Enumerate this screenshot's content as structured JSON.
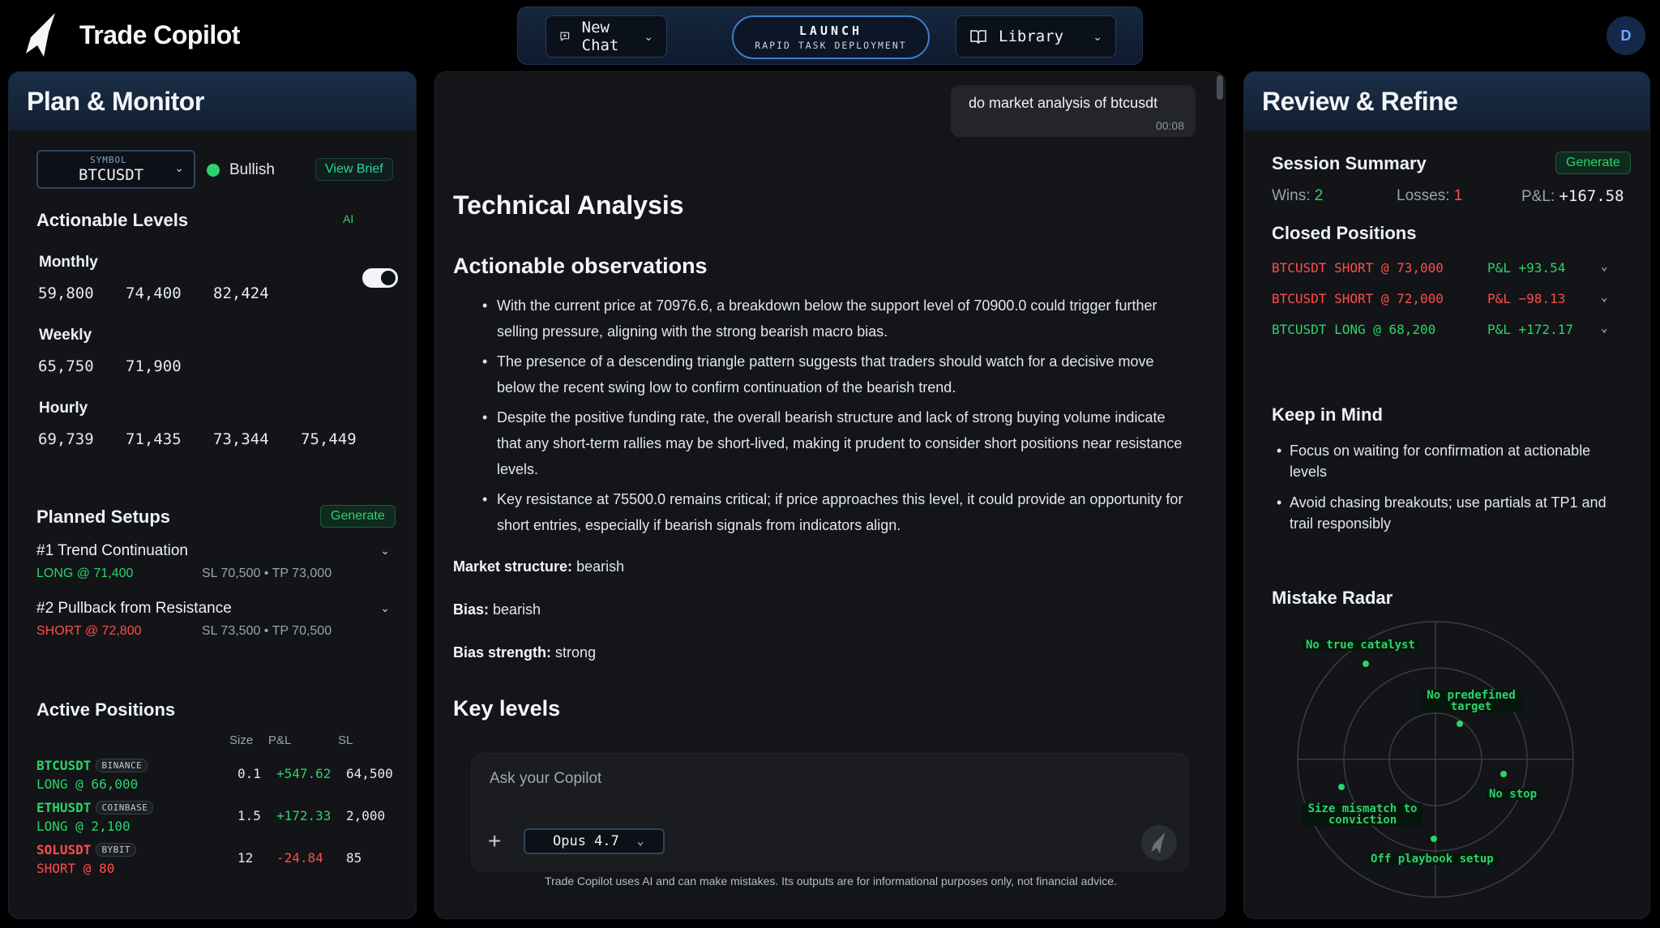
{
  "app": {
    "title": "Trade Copilot",
    "avatar_initial": "D"
  },
  "topnav": {
    "new_chat": "New Chat",
    "launch_title": "LAUNCH",
    "launch_subtitle": "RAPID TASK DEPLOYMENT",
    "library": "Library"
  },
  "left": {
    "title": "Plan & Monitor",
    "symbol_label": "SYMBOL",
    "symbol_value": "BTCUSDT",
    "sentiment": "Bullish",
    "view_brief": "View Brief",
    "actionable_title": "Actionable Levels",
    "ai_label": "AI",
    "levels": [
      {
        "name": "Monthly",
        "values": [
          "59,800",
          "74,400",
          "82,424"
        ]
      },
      {
        "name": "Weekly",
        "values": [
          "65,750",
          "71,900"
        ]
      },
      {
        "name": "Hourly",
        "values": [
          "69,739",
          "71,435",
          "73,344",
          "75,449"
        ]
      }
    ],
    "planned_title": "Planned Setups",
    "generate": "Generate",
    "setups": [
      {
        "title": "#1 Trend Continuation",
        "entry": "LONG @ 71,400",
        "targets": "SL 70,500 • TP 73,000",
        "side": "long"
      },
      {
        "title": "#2 Pullback from Resistance",
        "entry": "SHORT @ 72,800",
        "targets": "SL 73,500 • TP 70,500",
        "side": "short"
      }
    ],
    "active_title": "Active Positions",
    "cols": {
      "size": "Size",
      "pnl": "P&L",
      "sl": "SL"
    },
    "positions": [
      {
        "symbol": "BTCUSDT",
        "exchange": "BINANCE",
        "entry": "LONG @ 66,000",
        "size": "0.1",
        "pnl": "+547.62",
        "sl": "64,500",
        "side": "long"
      },
      {
        "symbol": "ETHUSDT",
        "exchange": "COINBASE",
        "entry": "LONG @ 2,100",
        "size": "1.5",
        "pnl": "+172.33",
        "sl": "2,000",
        "side": "long"
      },
      {
        "symbol": "SOLUSDT",
        "exchange": "BYBIT",
        "entry": "SHORT @ 80",
        "size": "12",
        "pnl": "-24.84",
        "sl": "85",
        "side": "short"
      }
    ]
  },
  "center": {
    "user_message": "do market analysis of btcusdt",
    "user_time": "00:08",
    "heading": "Technical Analysis",
    "obs_heading": "Actionable observations",
    "observations": [
      "With the current price at 70976.6, a breakdown below the support level of 70900.0 could trigger further selling pressure, aligning with the strong bearish macro bias.",
      "The presence of a descending triangle pattern suggests that traders should watch for a decisive move below the recent swing low to confirm continuation of the bearish trend.",
      "Despite the positive funding rate, the overall bearish structure and lack of strong buying volume indicate that any short-term rallies may be short-lived, making it prudent to consider short positions near resistance levels.",
      "Key resistance at 75500.0 remains critical; if price approaches this level, it could provide an opportunity for short entries, especially if bearish signals from indicators align."
    ],
    "market_structure_label": "Market structure:",
    "market_structure": "bearish",
    "bias_label": "Bias:",
    "bias": "bearish",
    "bias_strength_label": "Bias strength:",
    "bias_strength": "strong",
    "key_levels": "Key levels",
    "composer_placeholder": "Ask your Copilot",
    "model": "Opus 4.7",
    "disclaimer": "Trade Copilot uses AI and can make mistakes. Its outputs are for informational purposes only, not financial advice."
  },
  "right": {
    "title": "Review & Refine",
    "session_title": "Session Summary",
    "generate": "Generate",
    "wins_label": "Wins:",
    "wins": "2",
    "losses_label": "Losses:",
    "losses": "1",
    "pnl_label": "P&L:",
    "pnl": "+167.58",
    "closed_title": "Closed Positions",
    "closed": [
      {
        "trade": "BTCUSDT SHORT @ 73,000",
        "pnl": "P&L +93.54",
        "side": "short"
      },
      {
        "trade": "BTCUSDT SHORT @ 72,000",
        "pnl": "P&L −98.13",
        "side": "short"
      },
      {
        "trade": "BTCUSDT LONG @ 68,200",
        "pnl": "P&L +172.17",
        "side": "long"
      }
    ],
    "mind_title": "Keep in Mind",
    "mind": [
      "Focus on waiting for confirmation at actionable levels",
      "Avoid chasing breakouts; use partials at TP1 and trail responsibly"
    ],
    "radar_title": "Mistake Radar",
    "radar_labels": [
      "No true catalyst",
      "No predefined target",
      "No stop",
      "Size mismatch to conviction",
      "Off playbook setup"
    ]
  },
  "colors": {
    "green": "#2bd46a",
    "red": "#ff4d4d",
    "accent": "#3d7fc7"
  }
}
